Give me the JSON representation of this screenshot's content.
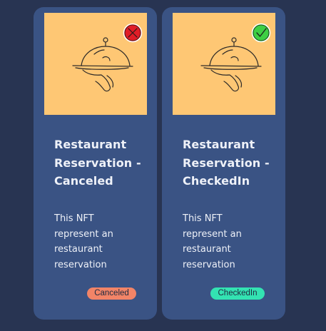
{
  "cards": [
    {
      "title": "Restaurant Reservation - Canceled",
      "description": "This NFT represent an restaurant reservation",
      "status": "Canceled",
      "status_icon": "x-circle-icon",
      "status_color": "#f28467",
      "icon_color": "#e11d27"
    },
    {
      "title": "Restaurant Reservation - CheckedIn",
      "description": "This NFT represent an restaurant reservation",
      "status": "CheckedIn",
      "status_icon": "check-circle-icon",
      "status_color": "#33e3b2",
      "icon_color": "#3ecf44"
    }
  ],
  "colors": {
    "background": "#283452",
    "card": "#3a5384",
    "image_background": "#fec774"
  }
}
